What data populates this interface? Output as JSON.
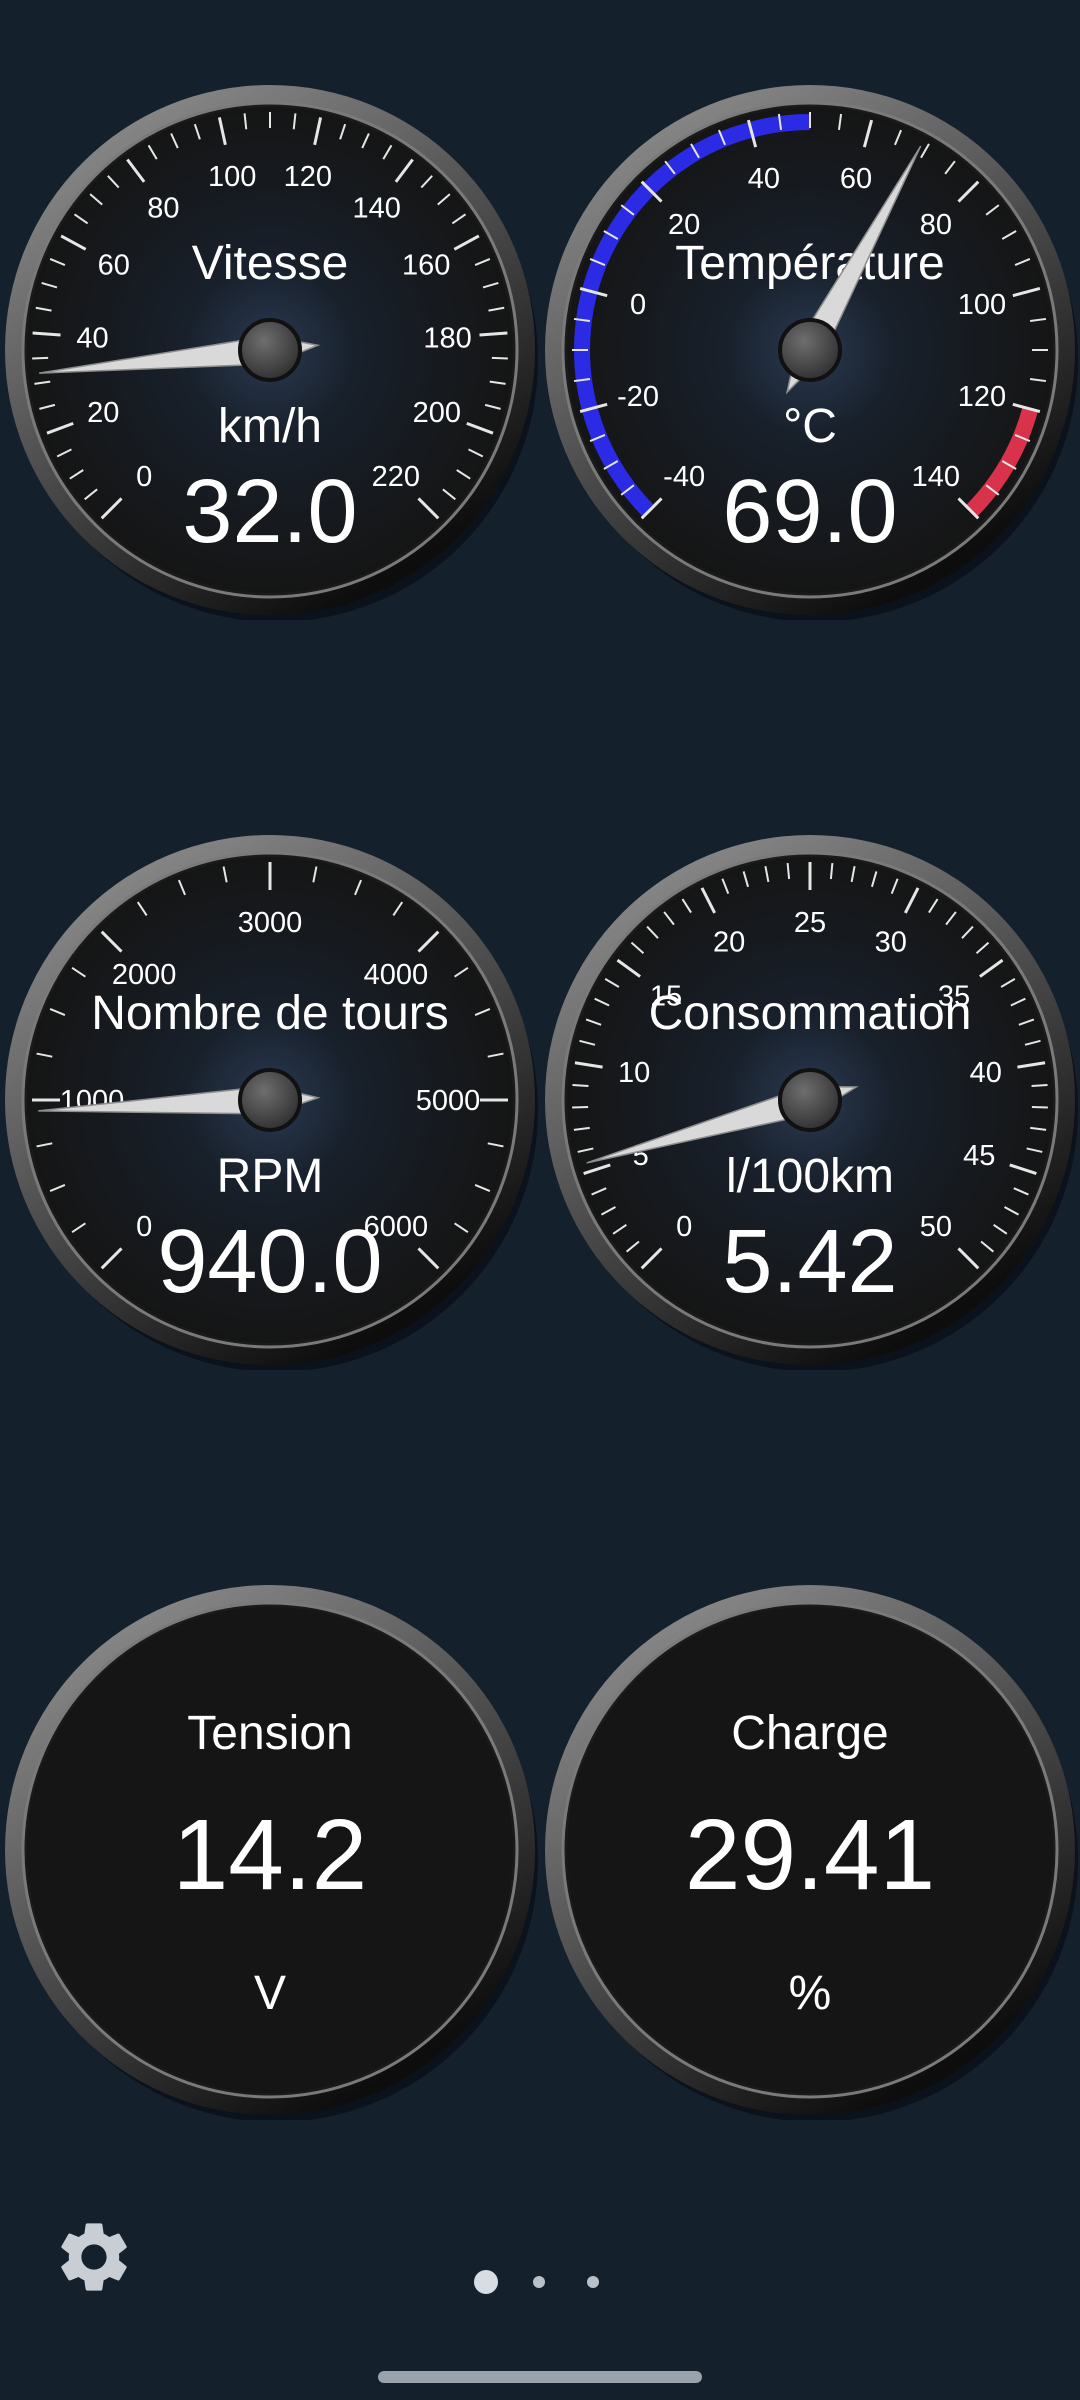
{
  "colors": {
    "background": "#15202d",
    "face": "#151515",
    "cold_arc": "#2b2be6",
    "hot_arc": "#d8334a"
  },
  "gauges": [
    {
      "id": "speed",
      "type": "analog",
      "title": "Vitesse",
      "unit": "km/h",
      "value": 32.0,
      "display_value": "32.0",
      "min": 0,
      "max": 220,
      "major_step": 20,
      "minor_step": 5,
      "ticks": [
        "0",
        "20",
        "40",
        "60",
        "80",
        "100",
        "120",
        "140",
        "160",
        "180",
        "200",
        "220"
      ],
      "zones": []
    },
    {
      "id": "temperature",
      "type": "analog",
      "title": "Température",
      "unit": "°C",
      "value": 69.0,
      "display_value": "69.0",
      "min": -40,
      "max": 140,
      "major_step": 20,
      "minor_step": 5,
      "ticks": [
        "-40",
        "-20",
        "0",
        "20",
        "40",
        "60",
        "80",
        "100",
        "120",
        "140"
      ],
      "zones": [
        {
          "from": -40,
          "to": 50,
          "color": "#2b2be6"
        },
        {
          "from": 120,
          "to": 140,
          "color": "#d8334a"
        }
      ]
    },
    {
      "id": "rpm",
      "type": "analog",
      "title": "Nombre de tours",
      "unit": "RPM",
      "value": 940.0,
      "display_value": "940.0",
      "min": 0,
      "max": 6000,
      "major_step": 1000,
      "minor_step": 250,
      "ticks": [
        "0",
        "1000",
        "2000",
        "3000",
        "4000",
        "5000",
        "6000"
      ],
      "zones": []
    },
    {
      "id": "consumption",
      "type": "analog",
      "title": "Consommation",
      "unit": "l/100km",
      "value": 5.42,
      "display_value": "5.42",
      "min": 0,
      "max": 50,
      "major_step": 5,
      "minor_step": 1,
      "ticks": [
        "0",
        "5",
        "10",
        "15",
        "20",
        "25",
        "30",
        "35",
        "40",
        "45",
        "50"
      ],
      "zones": []
    },
    {
      "id": "voltage",
      "type": "digital",
      "title": "Tension",
      "unit": "V",
      "value": 14.2,
      "display_value": "14.2"
    },
    {
      "id": "load",
      "type": "digital",
      "title": "Charge",
      "unit": "%",
      "value": 29.41,
      "display_value": "29.41"
    }
  ],
  "settings": {
    "icon": "gear-icon"
  },
  "pager": {
    "page_count": 3,
    "current_page": 1
  }
}
